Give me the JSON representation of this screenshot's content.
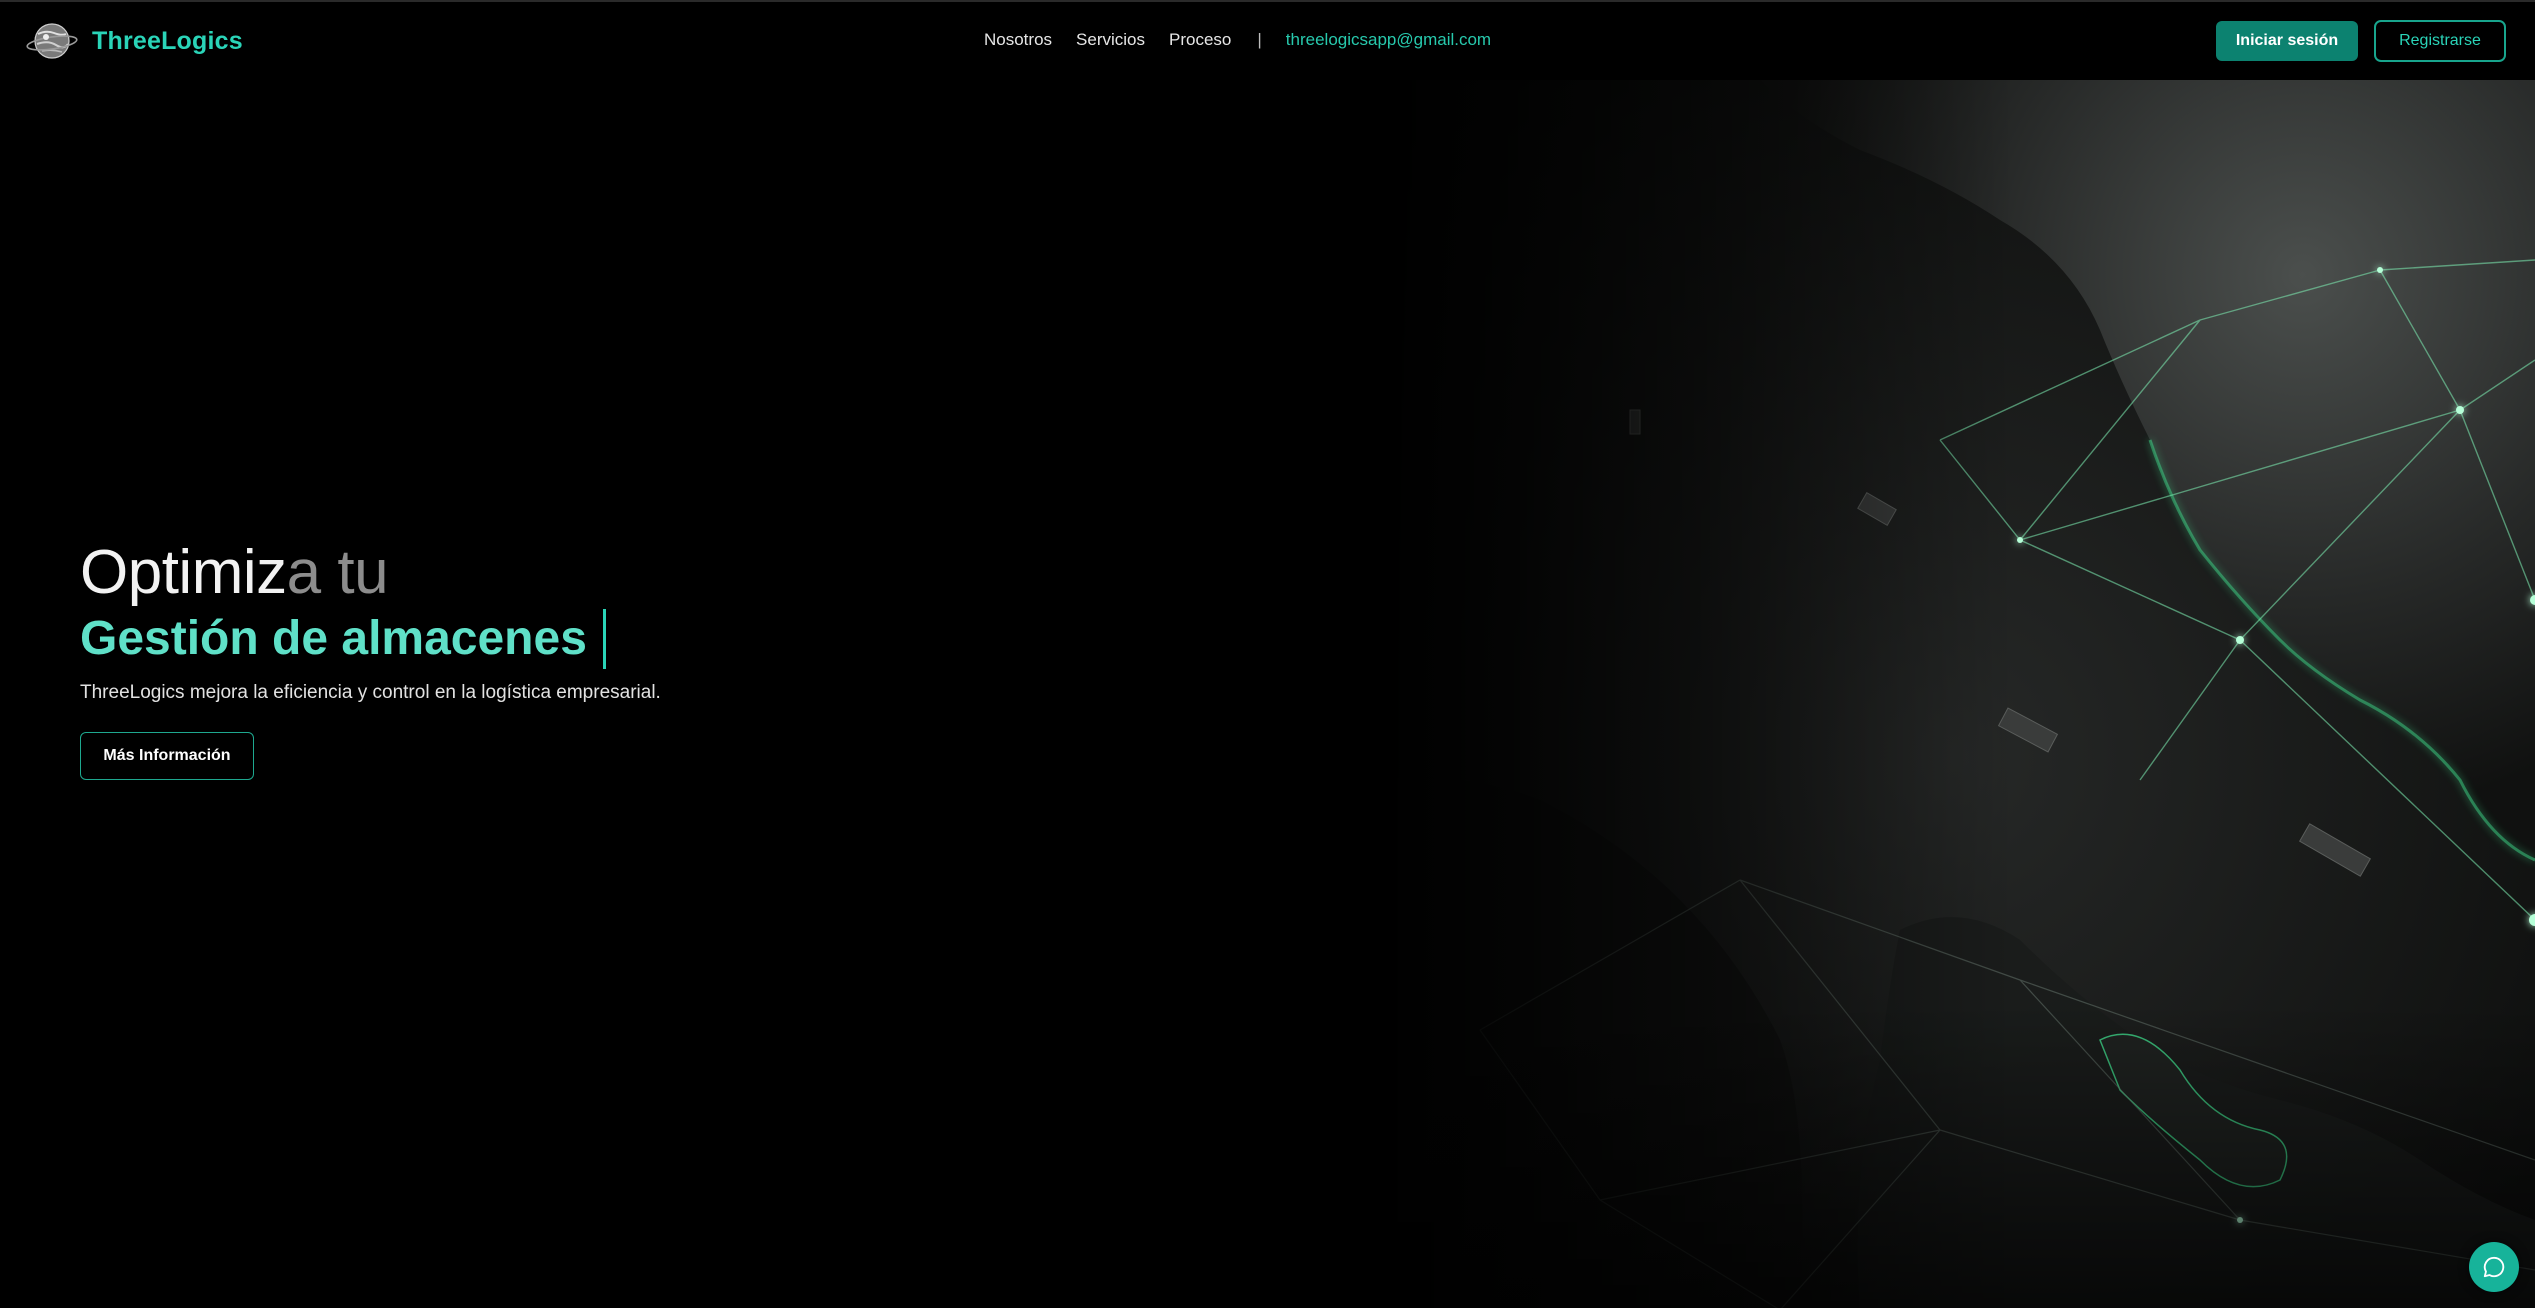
{
  "header": {
    "brand": "ThreeLogics",
    "nav": {
      "items": [
        "Nosotros",
        "Servicios",
        "Proceso"
      ],
      "separator": "|",
      "email": "threelogicsapp@gmail.com"
    },
    "login_label": "Iniciar sesión",
    "register_label": "Registrarse"
  },
  "hero": {
    "line1_bright": "Optimiz",
    "line1_dim": "a tu",
    "line2": "Gestión de almacenes",
    "subtitle": "ThreeLogics mejora la eficiencia y control en la logística empresarial.",
    "cta_label": "Más Información"
  },
  "icons": {
    "logo": "globe-logo-icon",
    "chat": "chat-bubble-icon"
  },
  "colors": {
    "accent": "#2ad4b8",
    "accent_dark": "#0c8270",
    "background": "#000000",
    "map_glow": "#4cf5a4"
  }
}
